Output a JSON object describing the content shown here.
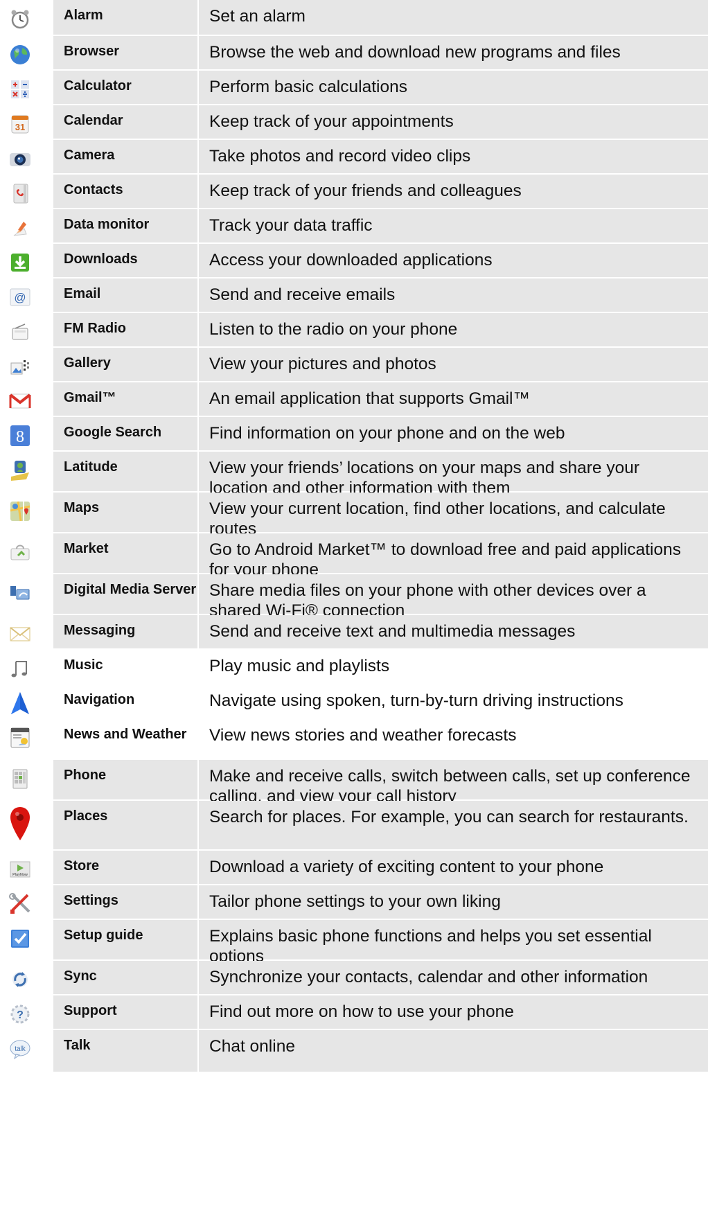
{
  "apps": [
    {
      "name": "Alarm",
      "description": "Set an alarm",
      "icon": "alarm-clock-icon"
    },
    {
      "name": "Browser",
      "description": "Browse the web and download new programs and files",
      "icon": "globe-icon"
    },
    {
      "name": "Calculator",
      "description": "Perform basic calculations",
      "icon": "calculator-icon"
    },
    {
      "name": "Calendar",
      "description": "Keep track of your appointments",
      "icon": "calendar-icon"
    },
    {
      "name": "Camera",
      "description": "Take photos and record video clips",
      "icon": "camera-icon"
    },
    {
      "name": "Contacts",
      "description": "Keep track of your friends and colleagues",
      "icon": "contacts-book-icon"
    },
    {
      "name": "Data monitor",
      "description": "Track your data traffic",
      "icon": "data-monitor-icon"
    },
    {
      "name": "Downloads",
      "description": "Access your downloaded applications",
      "icon": "download-arrow-icon"
    },
    {
      "name": "Email",
      "description": "Send and receive emails",
      "icon": "email-at-icon"
    },
    {
      "name": "FM Radio",
      "description": "Listen to the radio on your phone",
      "icon": "radio-icon"
    },
    {
      "name": "Gallery",
      "description": "View your pictures and photos",
      "icon": "gallery-icon"
    },
    {
      "name": "Gmail™",
      "description": "An email application that supports Gmail™",
      "icon": "gmail-envelope-icon"
    },
    {
      "name": "Google Search",
      "description": "Find information on your phone and on the web",
      "icon": "google-search-icon"
    },
    {
      "name": "Latitude",
      "description": "View your friends’ locations on your maps and share your location and other information with them",
      "icon": "latitude-icon"
    },
    {
      "name": "Maps",
      "description": "View your current location, find other locations, and calculate routes",
      "icon": "maps-icon"
    },
    {
      "name": "Market",
      "description": "Go to Android Market™ to download free and paid applications for your phone",
      "icon": "market-bag-icon"
    },
    {
      "name": "Digital Media Server",
      "description": "Share media files on your phone with other devices over a shared Wi-Fi® connection",
      "icon": "media-server-icon"
    },
    {
      "name": "Messaging",
      "description": "Send and receive text and multimedia messages",
      "icon": "envelope-icon"
    },
    {
      "name": "Music",
      "description": "Play music and playlists",
      "icon": "music-note-icon"
    },
    {
      "name": "Navigation",
      "description": "Navigate using spoken, turn-by-turn driving instructions",
      "icon": "navigation-arrow-icon"
    },
    {
      "name": "News and Weather",
      "description": "View news stories and weather forecasts",
      "icon": "news-weather-icon"
    },
    {
      "name": "Phone",
      "description": "Make and receive calls, switch between calls, set up conference calling, and view your call history",
      "icon": "phone-keypad-icon"
    },
    {
      "name": "Places",
      "description": "Search for places. For example, you can search for restaurants.",
      "icon": "map-pin-icon"
    },
    {
      "name": "Store",
      "description": "Download a variety of exciting content to your phone",
      "icon": "store-icon"
    },
    {
      "name": "Settings",
      "description": "Tailor phone settings to your own liking",
      "icon": "settings-tools-icon"
    },
    {
      "name": "Setup guide",
      "description": "Explains basic phone functions and helps you set essential options",
      "icon": "checkbox-icon"
    },
    {
      "name": "Sync",
      "description": "Synchronize your contacts, calendar and other information",
      "icon": "sync-icon"
    },
    {
      "name": "Support",
      "description": "Find out more on how to use your phone",
      "icon": "support-gear-icon"
    },
    {
      "name": "Talk",
      "description": "Chat online",
      "icon": "talk-bubble-icon"
    }
  ],
  "store_icon_text": "PlayNow",
  "talk_icon_text": "talk",
  "calendar_icon_text": "31",
  "google_icon_text": "8"
}
